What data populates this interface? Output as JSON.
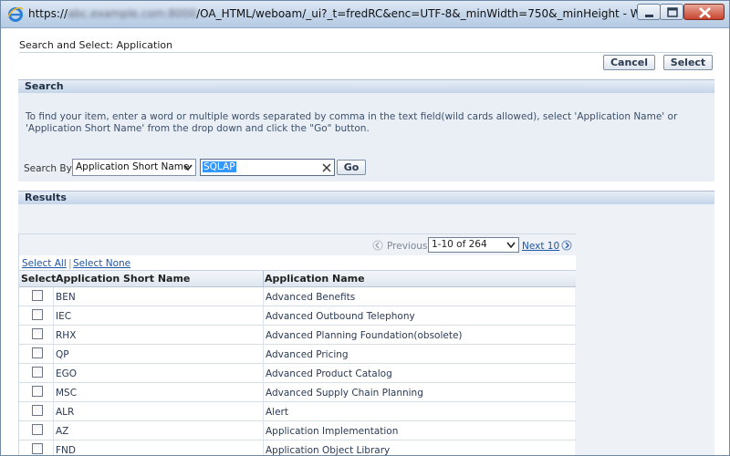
{
  "window": {
    "url_prefix": "https://",
    "url_host_blurred": "abc.example.com:8000",
    "url_path": "/OA_HTML/weboam/_ui?_t=fredRC&enc=UTF-8&_minWidth=750&_minHeight - Window...",
    "icon": "ie-icon",
    "controls": {
      "minimize": "minimize-icon",
      "maximize": "maximize-icon",
      "close": "close-icon"
    }
  },
  "page": {
    "title": "Search and Select: Application",
    "cancel_label": "Cancel",
    "select_label": "Select"
  },
  "search": {
    "header": "Search",
    "instructions": "To find your item, enter a word or multiple words separated by comma in the text field(wild cards allowed), select 'Application Name' or 'Application Short Name' from the drop down and click the \"Go\" button.",
    "search_by_label": "Search By",
    "search_by_value": "Application Short Name",
    "input_value": "SQLAP",
    "go_label": "Go"
  },
  "results": {
    "header": "Results",
    "pager": {
      "previous_label": "Previous",
      "range": "1-10 of 264",
      "next_label": "Next 10"
    },
    "select_all_label": "Select All",
    "select_none_label": "Select None",
    "columns": [
      "Select",
      "Application Short Name",
      "Application Name"
    ],
    "rows": [
      {
        "short": "BEN",
        "name": "Advanced Benefits"
      },
      {
        "short": "IEC",
        "name": "Advanced Outbound Telephony"
      },
      {
        "short": "RHX",
        "name": "Advanced Planning Foundation(obsolete)"
      },
      {
        "short": "QP",
        "name": "Advanced Pricing"
      },
      {
        "short": "EGO",
        "name": "Advanced Product Catalog"
      },
      {
        "short": "MSC",
        "name": "Advanced Supply Chain Planning"
      },
      {
        "short": "ALR",
        "name": "Alert"
      },
      {
        "short": "AZ",
        "name": "Application Implementation"
      },
      {
        "short": "FND",
        "name": "Application Object Library"
      }
    ]
  },
  "colors": {
    "link": "#1e56a8",
    "header_bg": "#c5d5e8",
    "panel_bg": "#eaeff6"
  }
}
